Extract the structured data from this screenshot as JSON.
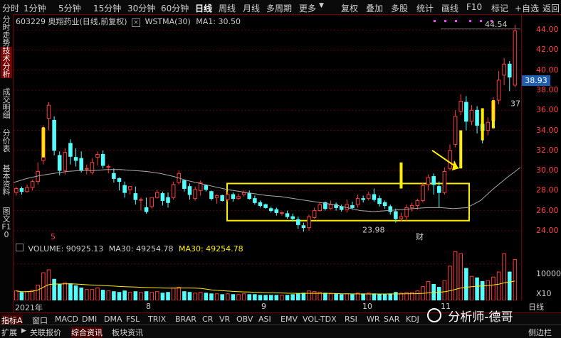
{
  "top_tabs": [
    "分时",
    "1分钟",
    "5分钟",
    "15分钟",
    "30分钟",
    "60分钟",
    "日线",
    "周线",
    "月线",
    "多周期",
    "更多"
  ],
  "active_tab": "日线",
  "tools": [
    "复权",
    "叠加",
    "多股",
    "统计",
    "画线",
    "F10",
    "标记",
    "+自选",
    "返回"
  ],
  "sidebar": [
    "分时走势",
    "技术分析",
    "成交明细",
    "分价表",
    "基本资料",
    "图文F10"
  ],
  "stock_info": {
    "code_name": "603229 奥翔药业(日线,前复权)",
    "ma_label": "WSTMA(30)",
    "ma_value": "MA1: 30.50"
  },
  "volume_info": {
    "volume": "VOLUME: 90925.13",
    "ma30": "MA30: 49254.78",
    "ma30b": "MA30: 49254.78"
  },
  "price_axis": [
    "44.00",
    "42.00",
    "40.00",
    "38.00",
    "36.00",
    "34.00",
    "32.00",
    "30.00",
    "28.00",
    "26.00",
    "24.00"
  ],
  "volume_axis": [
    "10000",
    "5000",
    "X10"
  ],
  "annotations": {
    "high": "44.54",
    "low": "23.98",
    "level": "37.2",
    "last_price": "38.93",
    "marker_5": "5",
    "marker_cai": "财"
  },
  "dates": [
    "2021年",
    "8",
    "9",
    "10",
    "11"
  ],
  "bottom_tabs": [
    "指标A",
    "窗口",
    "MACD",
    "DMI",
    "DMA",
    "FSL",
    "TRIX",
    "BRAR",
    "CR",
    "VR",
    "OBV",
    "ASI",
    "EMV",
    "VOL-TDX",
    "RSI",
    "WR",
    "SAR",
    "KDJ"
  ],
  "bottom_tabs2": [
    "扩展",
    "关联报价",
    "综合资讯",
    "板块资讯"
  ],
  "right_bottom": [
    "日线",
    "侧边栏"
  ],
  "watermark": "分析师-德哥",
  "colors": {
    "up": "#ff3c3c",
    "down": "#54ffff",
    "ma": "#aaaaaa",
    "box": "#ffee00",
    "accent": "#7a0000"
  },
  "chart_data": {
    "type": "candlestick",
    "ylim": [
      23,
      45.5
    ],
    "ma_line": [
      28.8,
      29.2,
      29.5,
      29.7,
      29.9,
      30.0,
      30.0,
      30.1,
      30.1,
      30.0,
      29.9,
      29.7,
      29.4,
      29.0,
      28.7,
      28.4,
      28.1,
      27.9,
      27.7,
      27.5,
      27.4,
      27.2,
      27.0,
      26.8,
      26.6,
      26.3,
      26.0,
      25.9,
      26.0,
      26.1,
      26.2,
      26.3,
      26.3,
      26.2,
      26.3,
      27.0,
      28.2,
      29.3,
      30.3
    ],
    "candles": [
      [
        27.8,
        28.2,
        27.5,
        28.4
      ],
      [
        28.2,
        27.9,
        27.6,
        28.4
      ],
      [
        27.9,
        28.3,
        27.8,
        28.6
      ],
      [
        28.3,
        28.9,
        28.0,
        29.1
      ],
      [
        28.9,
        29.9,
        28.6,
        30.8
      ],
      [
        31.0,
        34.2,
        30.6,
        34.5
      ],
      [
        35.2,
        36.5,
        34.0,
        36.8
      ],
      [
        35.0,
        32.0,
        31.5,
        35.4
      ],
      [
        31.5,
        30.0,
        29.5,
        31.9
      ],
      [
        30.0,
        31.8,
        29.6,
        32.2
      ],
      [
        32.7,
        31.4,
        30.6,
        33.1
      ],
      [
        31.3,
        31.0,
        30.4,
        32.2
      ],
      [
        31.2,
        30.0,
        29.8,
        31.9
      ],
      [
        30.2,
        30.2,
        29.6,
        30.6
      ],
      [
        29.8,
        30.8,
        29.6,
        31.2
      ],
      [
        31.3,
        31.6,
        30.5,
        31.9
      ],
      [
        31.6,
        30.5,
        30.2,
        32.0
      ],
      [
        30.4,
        30.4,
        29.7,
        30.6
      ],
      [
        29.7,
        29.2,
        28.8,
        30.2
      ],
      [
        29.2,
        28.9,
        28.0,
        29.3
      ],
      [
        28.5,
        27.8,
        27.3,
        28.9
      ],
      [
        28.1,
        28.4,
        27.6,
        28.4
      ],
      [
        27.7,
        27.1,
        26.6,
        28.4
      ],
      [
        27.1,
        27.1,
        26.0,
        27.3
      ],
      [
        26.3,
        25.9,
        25.7,
        27.3
      ],
      [
        26.4,
        27.3,
        26.2,
        27.3
      ],
      [
        27.3,
        27.8,
        27.2,
        28.1
      ],
      [
        27.7,
        27.0,
        26.5,
        27.9
      ],
      [
        27.3,
        26.8,
        26.3,
        27.8
      ],
      [
        27.3,
        28.6,
        27.1,
        28.9
      ],
      [
        28.8,
        29.7,
        28.6,
        30.0
      ],
      [
        29.0,
        28.2,
        27.9,
        29.1
      ],
      [
        28.4,
        27.6,
        27.1,
        28.7
      ],
      [
        27.2,
        28.1,
        27.0,
        28.4
      ],
      [
        28.0,
        28.8,
        27.5,
        29.0
      ],
      [
        28.5,
        28.1,
        27.9,
        28.6
      ],
      [
        27.9,
        27.2,
        27.0,
        28.0
      ],
      [
        27.3,
        27.5,
        26.7,
        27.6
      ],
      [
        27.5,
        27.0,
        26.9,
        27.6
      ],
      [
        27.1,
        27.6,
        26.9,
        27.9
      ],
      [
        27.6,
        27.2,
        26.9,
        27.8
      ],
      [
        27.2,
        27.4,
        27.1,
        27.7
      ],
      [
        27.6,
        27.8,
        27.4,
        28.0
      ],
      [
        27.7,
        27.2,
        27.1,
        28.0
      ],
      [
        27.2,
        26.8,
        26.6,
        27.5
      ],
      [
        26.8,
        26.5,
        26.3,
        27.0
      ],
      [
        26.6,
        26.3,
        26.2,
        26.7
      ],
      [
        26.2,
        26.0,
        25.8,
        26.4
      ],
      [
        26.1,
        25.8,
        25.5,
        26.3
      ],
      [
        25.8,
        25.8,
        25.5,
        25.9
      ],
      [
        25.7,
        25.4,
        25.2,
        26.0
      ],
      [
        25.4,
        25.2,
        24.9,
        25.7
      ],
      [
        25.1,
        24.6,
        24.2,
        25.4
      ],
      [
        24.5,
        24.3,
        23.9,
        24.8
      ],
      [
        24.3,
        25.4,
        24.0,
        25.6
      ],
      [
        25.3,
        26.0,
        25.2,
        26.3
      ],
      [
        26.0,
        26.6,
        25.9,
        26.8
      ],
      [
        26.8,
        26.2,
        26.0,
        26.9
      ],
      [
        26.2,
        26.6,
        26.1,
        27.0
      ],
      [
        26.6,
        26.3,
        26.0,
        26.8
      ],
      [
        26.4,
        26.1,
        25.9,
        26.6
      ],
      [
        26.1,
        26.6,
        25.8,
        27.1
      ],
      [
        26.5,
        26.3,
        26.1,
        26.9
      ],
      [
        26.6,
        27.2,
        26.3,
        27.6
      ],
      [
        27.2,
        27.1,
        26.8,
        27.5
      ],
      [
        27.2,
        27.6,
        27.0,
        27.9
      ],
      [
        27.6,
        27.1,
        26.9,
        28.2
      ],
      [
        27.2,
        26.7,
        26.4,
        27.5
      ],
      [
        26.8,
        26.5,
        26.2,
        27.0
      ],
      [
        26.4,
        25.9,
        25.6,
        26.6
      ],
      [
        25.9,
        25.2,
        24.8,
        26.2
      ],
      [
        25.2,
        25.4,
        24.9,
        25.8
      ],
      [
        25.4,
        26.3,
        25.0,
        26.6
      ],
      [
        26.3,
        26.5,
        25.9,
        26.8
      ],
      [
        26.5,
        27.0,
        26.1,
        27.2
      ],
      [
        27.0,
        28.5,
        26.8,
        28.8
      ],
      [
        28.6,
        29.3,
        28.0,
        29.6
      ],
      [
        29.4,
        28.6,
        27.6,
        29.7
      ],
      [
        28.4,
        27.8,
        26.3,
        28.9
      ],
      [
        27.8,
        29.9,
        27.6,
        30.3
      ],
      [
        30.2,
        32.0,
        30.0,
        32.6
      ],
      [
        32.6,
        35.4,
        32.3,
        36.0
      ],
      [
        35.9,
        36.9,
        35.5,
        37.6
      ],
      [
        36.8,
        34.9,
        34.0,
        37.4
      ],
      [
        34.9,
        36.0,
        34.5,
        36.5
      ],
      [
        36.0,
        34.5,
        33.7,
        36.4
      ],
      [
        34.6,
        34.0,
        32.7,
        35.0
      ],
      [
        34.0,
        34.8,
        33.5,
        35.3
      ],
      [
        35.0,
        36.9,
        34.5,
        37.3
      ],
      [
        37.0,
        39.0,
        36.6,
        39.9
      ],
      [
        39.5,
        40.6,
        38.5,
        41.2
      ],
      [
        40.6,
        39.3,
        37.9,
        40.9
      ],
      [
        38.5,
        43.9,
        38.3,
        44.5
      ]
    ],
    "volumes": [
      1300,
      1100,
      1200,
      1400,
      2100,
      3800,
      4200,
      2900,
      2200,
      2400,
      2300,
      2000,
      1700,
      1500,
      1500,
      1700,
      1400,
      1300,
      1200,
      1100,
      1300,
      1100,
      1200,
      1100,
      1200,
      1100,
      1200,
      1000,
      1100,
      1700,
      1800,
      1200,
      1100,
      1000,
      1100,
      1000,
      900,
      900,
      800,
      900,
      800,
      800,
      900,
      800,
      800,
      700,
      700,
      700,
      700,
      700,
      700,
      800,
      900,
      1000,
      1300,
      1200,
      1100,
      1000,
      900,
      900,
      800,
      900,
      800,
      1000,
      900,
      1000,
      900,
      800,
      800,
      900,
      1100,
      1000,
      1100,
      1100,
      1300,
      1900,
      2600,
      2200,
      1800,
      2700,
      4700,
      6700,
      6400,
      4400,
      3300,
      3100,
      2600,
      2700,
      3200,
      3900,
      6400,
      3900,
      5600
    ]
  }
}
